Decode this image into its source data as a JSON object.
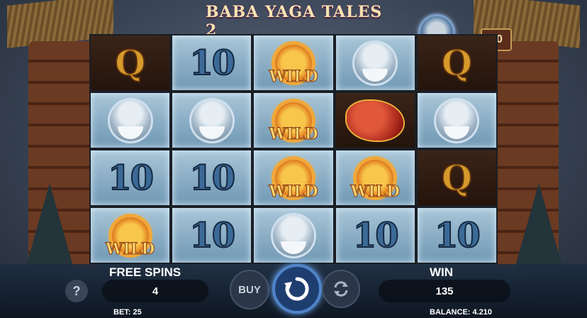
{
  "game": {
    "title": "BABA YAGA TALES 2",
    "lines": "50"
  },
  "reels": [
    [
      "Q",
      "10",
      "WILD",
      "OLDMAN",
      "Q"
    ],
    [
      "OLDMAN",
      "OLDMAN",
      "WILD",
      "DRAGON",
      "OLDMAN"
    ],
    [
      "10",
      "10",
      "WILD",
      "WILD",
      "Q"
    ],
    [
      "WILD",
      "10",
      "OLDMAN",
      "10",
      "10"
    ]
  ],
  "symbol_labels": {
    "Q": "Q",
    "10": "10",
    "WILD": "WILD"
  },
  "controls": {
    "free_spins_label": "FREE SPINS",
    "free_spins_value": "4",
    "win_label": "WIN",
    "win_value": "135",
    "buy_label": "BUY",
    "help_label": "?",
    "bet_text": "BET: 25",
    "balance_text": "BALANCE: 4.210"
  },
  "icons": {
    "spin": "spin-arrow-icon",
    "autoplay": "autoplay-icon",
    "help": "help-icon"
  },
  "colors": {
    "accent": "#4f84c8",
    "wild_gold": "#ffd870",
    "text": "#ffffff"
  }
}
